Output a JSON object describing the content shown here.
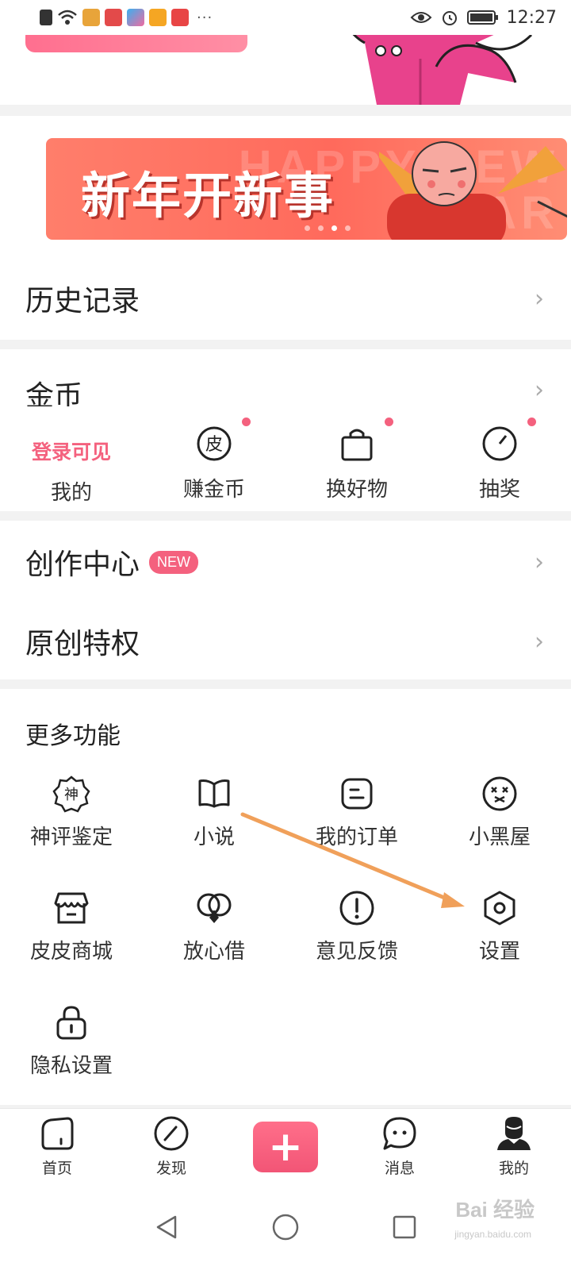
{
  "status_bar": {
    "time": "12:27",
    "more": "···"
  },
  "banner": {
    "text": "新年开新事",
    "bg_text_1": "HAPPY NEW",
    "bg_text_2": "YEAR"
  },
  "history": {
    "label": "历史记录"
  },
  "coins": {
    "title": "金币",
    "login_text": "登录可见",
    "items": [
      {
        "label": "我的"
      },
      {
        "label": "赚金币",
        "icon_char": "皮"
      },
      {
        "label": "换好物"
      },
      {
        "label": "抽奖"
      }
    ]
  },
  "creator": {
    "label": "创作中心",
    "badge": "NEW"
  },
  "original": {
    "label": "原创特权"
  },
  "more": {
    "title": "更多功能",
    "items": [
      {
        "label": "神评鉴定",
        "icon": "shen-badge-icon",
        "icon_char": "神"
      },
      {
        "label": "小说",
        "icon": "book-icon"
      },
      {
        "label": "我的订单",
        "icon": "order-icon"
      },
      {
        "label": "小黑屋",
        "icon": "dizzy-face-icon"
      },
      {
        "label": "皮皮商城",
        "icon": "shop-icon"
      },
      {
        "label": "放心借",
        "icon": "loan-icon"
      },
      {
        "label": "意见反馈",
        "icon": "feedback-icon"
      },
      {
        "label": "设置",
        "icon": "settings-icon"
      },
      {
        "label": "隐私设置",
        "icon": "lock-icon"
      }
    ]
  },
  "bottom_nav": {
    "items": [
      {
        "label": "首页"
      },
      {
        "label": "发现"
      },
      {
        "label": "+"
      },
      {
        "label": "消息"
      },
      {
        "label": "我的"
      }
    ]
  },
  "watermark": {
    "text": "Bai 经验",
    "sub": "jingyan.baidu.com"
  },
  "colors": {
    "accent": "#f4617e",
    "annotation_arrow": "#f0a05a"
  }
}
